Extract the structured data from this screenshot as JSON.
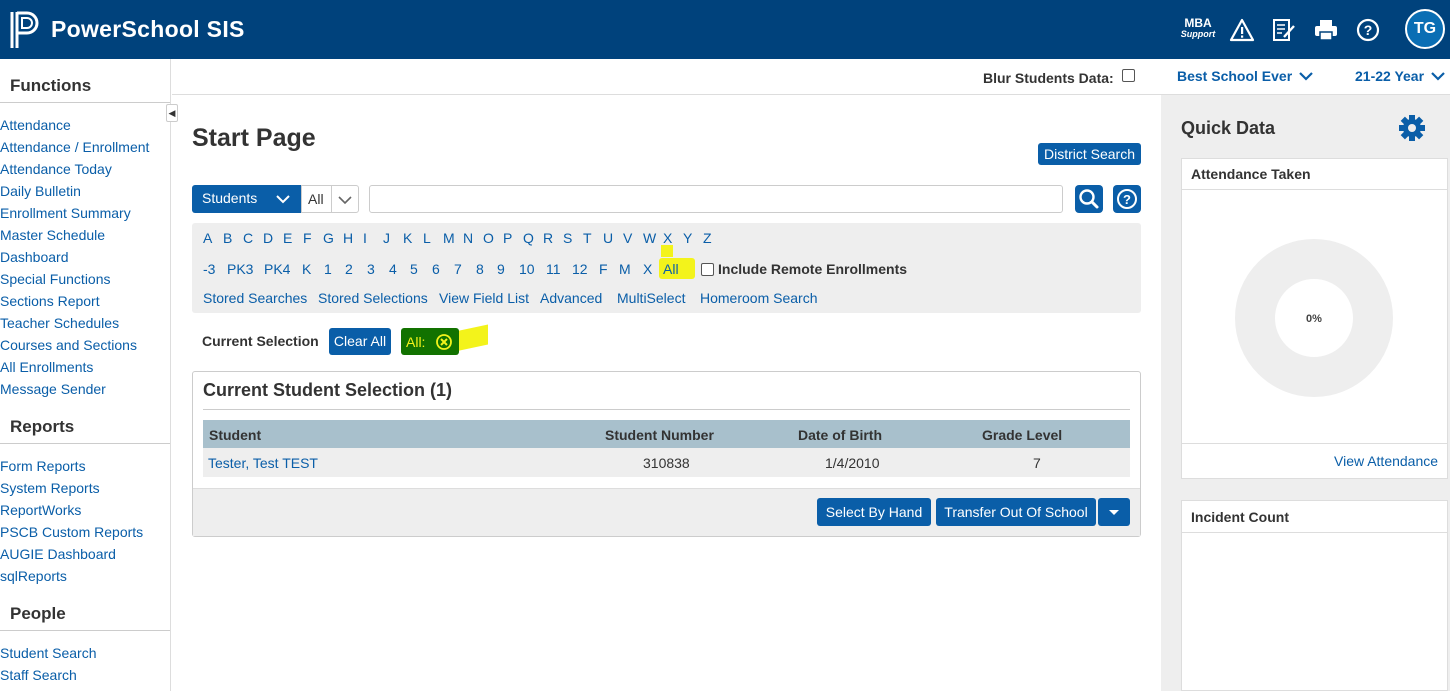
{
  "app": {
    "title": "PowerSchool SIS"
  },
  "topbar": {
    "mba_line1": "MBA",
    "mba_line2": "Support",
    "icons": [
      "alert-icon",
      "grade-entry-icon",
      "print-icon",
      "help-icon"
    ],
    "avatar_initials": "TG"
  },
  "subbar": {
    "blur_label": "Blur Students Data:",
    "school": "Best School Ever",
    "term": "21-22 Year"
  },
  "sidebar": {
    "sections": [
      {
        "heading": "Functions",
        "items": [
          "Attendance",
          "Attendance / Enrollment",
          "Attendance Today",
          "Daily Bulletin",
          "Enrollment Summary",
          "Master Schedule",
          "Dashboard",
          "Special Functions",
          "Sections Report",
          "Teacher Schedules",
          "Courses and Sections",
          "All Enrollments",
          "Message Sender"
        ]
      },
      {
        "heading": "Reports",
        "items": [
          "Form Reports",
          "System Reports",
          "ReportWorks",
          "PSCB Custom Reports",
          "AUGIE Dashboard",
          "sqlReports"
        ]
      },
      {
        "heading": "People",
        "items": [
          "Student Search",
          "Staff Search"
        ]
      }
    ]
  },
  "main": {
    "page_title": "Start Page",
    "district_search": "District Search",
    "search_type": "Students",
    "search_scope": "All",
    "search_value": "",
    "letters": [
      "A",
      "B",
      "C",
      "D",
      "E",
      "F",
      "G",
      "H",
      "I",
      "J",
      "K",
      "L",
      "M",
      "N",
      "O",
      "P",
      "Q",
      "R",
      "S",
      "T",
      "U",
      "V",
      "W",
      "X",
      "Y",
      "Z"
    ],
    "grades": [
      "-3",
      "PK3",
      "PK4",
      "K",
      "1",
      "2",
      "3",
      "4",
      "5",
      "6",
      "7",
      "8",
      "9",
      "10",
      "11",
      "12",
      "F",
      "M",
      "X",
      "All"
    ],
    "include_remote": "Include Remote Enrollments",
    "links": [
      "Stored Searches",
      "Stored Selections",
      "View Field List",
      "Advanced",
      "MultiSelect",
      "Homeroom Search"
    ],
    "current_selection_label": "Current Selection",
    "clear_all": "Clear All",
    "filter_tag": "All:"
  },
  "selection": {
    "title": "Current Student Selection (1)",
    "columns": [
      "Student",
      "Student Number",
      "Date of Birth",
      "Grade Level"
    ],
    "rows": [
      {
        "student": "Tester, Test TEST",
        "number": "310838",
        "dob": "1/4/2010",
        "grade": "7"
      }
    ],
    "select_by_hand": "Select By Hand",
    "transfer_out": "Transfer Out Of School"
  },
  "quick_data": {
    "title": "Quick Data",
    "attendance_title": "Attendance Taken",
    "attendance_percent": "0%",
    "attendance_value": 0,
    "view_attendance": "View Attendance",
    "incident_title": "Incident Count"
  },
  "colors": {
    "brand": "#00427c",
    "link": "#0a5ea8",
    "highlight": "#f3f31b",
    "tag": "#127200"
  }
}
